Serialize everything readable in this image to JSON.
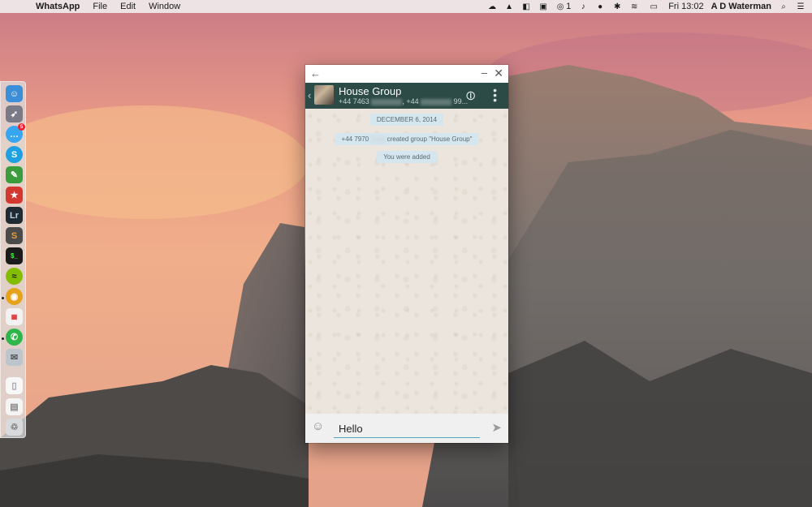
{
  "menubar": {
    "app_name": "WhatsApp",
    "menus": [
      "File",
      "Edit",
      "Window"
    ],
    "notification_count": "1",
    "clock": "Fri 13:02",
    "user": "A D Waterman"
  },
  "dock": {
    "items": [
      {
        "name": "finder",
        "color": "#3b8fd8"
      },
      {
        "name": "launchpad",
        "color": "#7a7a86"
      },
      {
        "name": "messages",
        "color": "#36a6f0",
        "badge": "5"
      },
      {
        "name": "skype",
        "color": "#1ea0e3",
        "glyph": "S"
      },
      {
        "name": "evernote",
        "color": "#3a9c3a"
      },
      {
        "name": "wunderlist",
        "color": "#d4372f"
      },
      {
        "name": "lightroom",
        "color": "#1f2a33",
        "glyph": "Lr"
      },
      {
        "name": "sublime-text",
        "color": "#4b4b4b",
        "glyph": "S"
      },
      {
        "name": "terminal",
        "color": "#1b1b1b"
      },
      {
        "name": "spotify",
        "color": "#84bd00"
      },
      {
        "name": "chrome",
        "color": "#e5a21b"
      },
      {
        "name": "fantastical",
        "color": "#f2f2f2"
      },
      {
        "name": "whatsapp",
        "color": "#2fb64b"
      },
      {
        "name": "mail",
        "color": "#bcc4cc"
      },
      {
        "name": "document",
        "color": "#f7f7f7"
      },
      {
        "name": "downloads",
        "color": "#f4f4f4"
      },
      {
        "name": "trash",
        "color": "#d6dadd"
      }
    ]
  },
  "window": {
    "header": {
      "group_name": "House Group",
      "participant_1": "+44 7463",
      "participant_2": "+44",
      "participant_3": "99..."
    },
    "messages": {
      "date": "DECEMBER 6, 2014",
      "created_prefix": "+44 7970",
      "created_suffix": "created group \"House Group\"",
      "added": "You were added"
    },
    "input": {
      "value": "Hello"
    }
  }
}
